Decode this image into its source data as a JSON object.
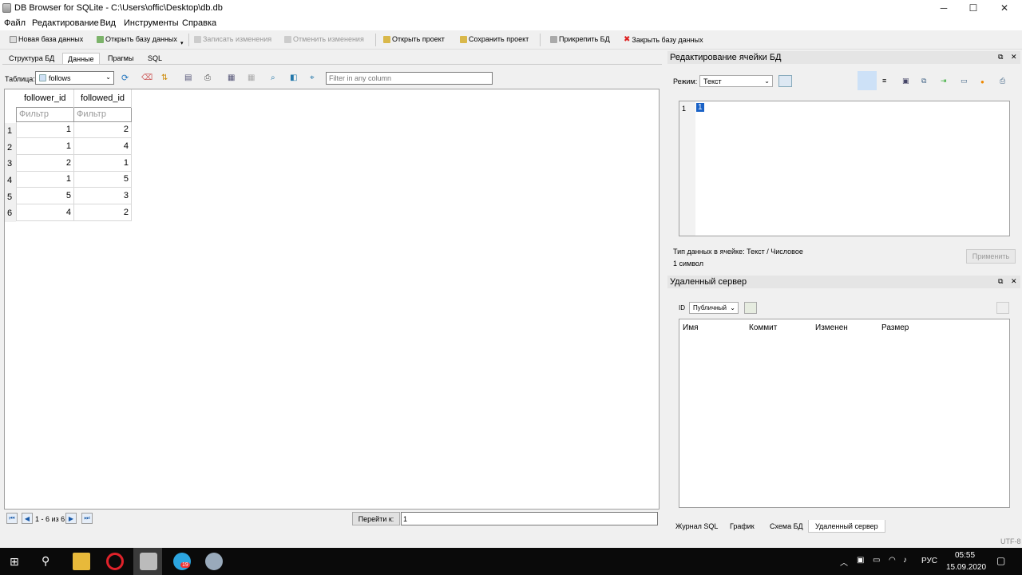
{
  "window": {
    "title": "DB Browser for SQLite - C:\\Users\\offic\\Desktop\\db.db",
    "min": "─",
    "max": "☐",
    "close": "✕"
  },
  "menu": [
    "Файл",
    "Редактирование",
    "Вид",
    "Инструменты",
    "Справка"
  ],
  "toolbar": {
    "new_db": "Новая база данных",
    "open_db": "Открыть базу данных",
    "write": "Записать изменения",
    "revert": "Отменить изменения",
    "open_proj": "Открыть проект",
    "save_proj": "Сохранить проект",
    "attach": "Прикрепить БД",
    "close_db": "Закрыть базу данных"
  },
  "tabs": [
    "Структура БД",
    "Данные",
    "Прагмы",
    "SQL"
  ],
  "browse": {
    "table_label": "Таблица:",
    "table_value": "follows",
    "filter_placeholder": "Filter in any column"
  },
  "grid": {
    "columns": [
      "follower_id",
      "followed_id"
    ],
    "filter": "Фильтр",
    "rows": [
      [
        "1",
        "1",
        "2"
      ],
      [
        "2",
        "1",
        "4"
      ],
      [
        "3",
        "2",
        "1"
      ],
      [
        "4",
        "1",
        "5"
      ],
      [
        "5",
        "5",
        "3"
      ],
      [
        "6",
        "4",
        "2"
      ]
    ]
  },
  "nav": {
    "status": "1 - 6 из 6",
    "goto_label": "Перейти к:",
    "goto_value": "1"
  },
  "edit_cell": {
    "title": "Редактирование ячейки БД",
    "mode_label": "Режим:",
    "mode_value": "Текст",
    "line_no": "1",
    "content": "1",
    "type_info": "Тип данных в ячейке: Текст / Числовое",
    "char_count": "1 символ",
    "apply": "Применить"
  },
  "remote": {
    "title": "Удаленный сервер",
    "id_label": "ID",
    "id_value": "Публичный",
    "columns": [
      "Имя",
      "Коммит",
      "Изменен",
      "Размер"
    ]
  },
  "bottom_tabs": [
    "Журнал SQL",
    "График",
    "Схема БД",
    "Удаленный сервер"
  ],
  "status_bar": {
    "encoding": "UTF-8"
  },
  "taskbar": {
    "lang": "РУС",
    "time": "05:55",
    "date": "15.09.2020",
    "badge": "19"
  }
}
